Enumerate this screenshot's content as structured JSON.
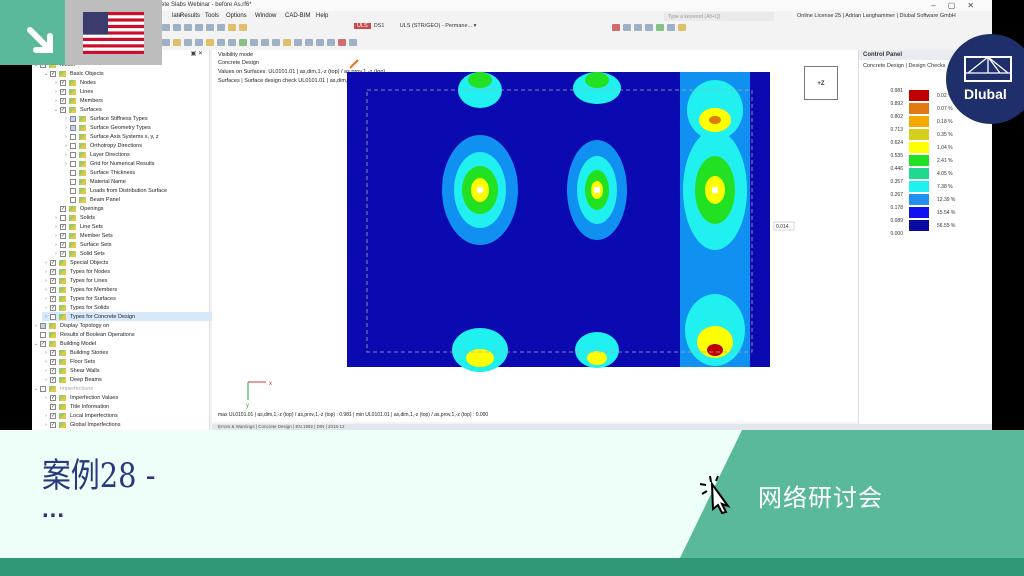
{
  "window": {
    "title": "crete Slabs Webinar - before As.rf6*",
    "minimize": "–",
    "maximize": "▢",
    "close": "✕"
  },
  "menu": [
    "late",
    "Results",
    "Tools",
    "Options",
    "Window",
    "CAD-BIM",
    "Help"
  ],
  "search": {
    "placeholder": "Type a keyword (Alt+Q)"
  },
  "licence": "Online License 25 | Adrian Langhammer | Dlubal Software GmbH",
  "toolbar": {
    "ds_badge": "ULS",
    "ds": "DS1",
    "combo": "ULS (STR/GEO) - Permane..."
  },
  "tree": [
    {
      "label": "Model",
      "level": 0,
      "checked": true,
      "expanded": true,
      "arrow": "v"
    },
    {
      "label": "Basic Objects",
      "level": 1,
      "checked": true,
      "arrow": "v"
    },
    {
      "label": "Nodes",
      "level": 2,
      "checked": true,
      "arrow": ">"
    },
    {
      "label": "Lines",
      "level": 2,
      "checked": true,
      "arrow": ">"
    },
    {
      "label": "Members",
      "level": 2,
      "checked": true,
      "arrow": ">"
    },
    {
      "label": "Surfaces",
      "level": 2,
      "checked": true,
      "arrow": "v"
    },
    {
      "label": "Surface Stiffness Types",
      "level": 3,
      "checked": "partial",
      "arrow": ">"
    },
    {
      "label": "Surface Geometry Types",
      "level": 3,
      "checked": "partial",
      "arrow": ">"
    },
    {
      "label": "Surface Axis Systems x, y, z",
      "level": 3,
      "checked": false,
      "arrow": ">"
    },
    {
      "label": "Orthotropy Directions",
      "level": 3,
      "checked": false,
      "arrow": ">"
    },
    {
      "label": "Layer Directions",
      "level": 3,
      "checked": false,
      "arrow": ">"
    },
    {
      "label": "Grid for Numerical Results",
      "level": 3,
      "checked": false,
      "arrow": ">"
    },
    {
      "label": "Surface Thickness",
      "level": 3,
      "checked": false,
      "arrow": ""
    },
    {
      "label": "Material Name",
      "level": 3,
      "checked": false,
      "arrow": ""
    },
    {
      "label": "Loads from Distribution Surface",
      "level": 3,
      "checked": false,
      "arrow": ""
    },
    {
      "label": "Beam Panel",
      "level": 3,
      "checked": false,
      "arrow": ""
    },
    {
      "label": "Openings",
      "level": 2,
      "checked": true,
      "arrow": ""
    },
    {
      "label": "Solids",
      "level": 2,
      "checked": false,
      "arrow": ">"
    },
    {
      "label": "Line Sets",
      "level": 2,
      "checked": true,
      "arrow": ">"
    },
    {
      "label": "Member Sets",
      "level": 2,
      "checked": true,
      "arrow": ">"
    },
    {
      "label": "Surface Sets",
      "level": 2,
      "checked": true,
      "arrow": ">"
    },
    {
      "label": "Solid Sets",
      "level": 2,
      "checked": true,
      "arrow": ">"
    },
    {
      "label": "Special Objects",
      "level": 1,
      "checked": true,
      "arrow": ">"
    },
    {
      "label": "Types for Nodes",
      "level": 1,
      "checked": true,
      "arrow": ">"
    },
    {
      "label": "Types for Lines",
      "level": 1,
      "checked": true,
      "arrow": ">"
    },
    {
      "label": "Types for Members",
      "level": 1,
      "checked": true,
      "arrow": ">"
    },
    {
      "label": "Types for Surfaces",
      "level": 1,
      "checked": true,
      "arrow": ">"
    },
    {
      "label": "Types for Solids",
      "level": 1,
      "checked": true,
      "arrow": ">"
    },
    {
      "label": "Types for Concrete Design",
      "level": 1,
      "checked": false,
      "arrow": ">",
      "selected": true
    },
    {
      "label": "Display Topology on",
      "level": 0,
      "checked": "partial",
      "arrow": ">"
    },
    {
      "label": "Results of Boolean Operations",
      "level": 0,
      "checked": false,
      "arrow": ""
    },
    {
      "label": "Building Model",
      "level": 0,
      "checked": true,
      "arrow": "v"
    },
    {
      "label": "Building Stories",
      "level": 1,
      "checked": true,
      "arrow": ">"
    },
    {
      "label": "Floor Sets",
      "level": 1,
      "checked": true,
      "arrow": ">"
    },
    {
      "label": "Shear Walls",
      "level": 1,
      "checked": true,
      "arrow": ">"
    },
    {
      "label": "Deep Beams",
      "level": 1,
      "checked": true,
      "arrow": ">"
    },
    {
      "label": "Imperfections",
      "level": 0,
      "checked": false,
      "arrow": "v",
      "gray": true
    },
    {
      "label": "Imperfection Values",
      "level": 1,
      "checked": true,
      "arrow": ">"
    },
    {
      "label": "Title Information",
      "level": 1,
      "checked": true,
      "arrow": ""
    },
    {
      "label": "Local Imperfections",
      "level": 1,
      "checked": true,
      "arrow": ">"
    },
    {
      "label": "Global Imperfections",
      "level": 1,
      "checked": true,
      "arrow": ">"
    }
  ],
  "viewport": {
    "info": [
      "Visibility mode",
      "Concrete Design",
      "Values on Surfaces: UL0101.01 | as,dim,1,-z (top) / as,prov,1,-z (top)",
      "Surfaces | Surface design check UL0101.01 | as,dim,1,-z (top) / as,prov,1,-z (top)"
    ],
    "navcube": "+Z",
    "label_value": "0.014",
    "maxmin": "max UL0101.01 | as,dim,1,-z (top) / as,prov,1,-z (top) : 0.981 | min UL0101.01 | as,dim,1,-z (top) / as,prov,1,-z (top) : 0.000",
    "status": "Errors & Warnings | Concrete Design | EN 1992 | DIN | 2015-12",
    "axis_x": "x",
    "axis_y": "y"
  },
  "control_panel": {
    "title": "Control Panel",
    "subtitle": "Concrete Design | Design Checks",
    "values": [
      "0.981",
      "0.892",
      "0.802",
      "0.713",
      "0.624",
      "0.535",
      "0.446",
      "0.357",
      "0.267",
      "0.178",
      "0.089",
      "0.000"
    ],
    "colors": [
      "#c00000",
      "#e07a10",
      "#f5a800",
      "#d4cf1a",
      "#ffff00",
      "#22e022",
      "#20d890",
      "#20f0f0",
      "#2090f0",
      "#1010f0",
      "#0a0aa0"
    ],
    "percents": [
      "0.02 %",
      "0.07 %",
      "0.18 %",
      "0.35 %",
      "1.04 %",
      "2.41 %",
      "4.05 %",
      "7.38 %",
      "12.39 %",
      "15.54 %",
      "56.55 %"
    ]
  },
  "overlay": {
    "logo": "Dlubal"
  },
  "banner": {
    "title": "案例28 -",
    "ellipsis": "...",
    "tag": "网络研讨会"
  }
}
